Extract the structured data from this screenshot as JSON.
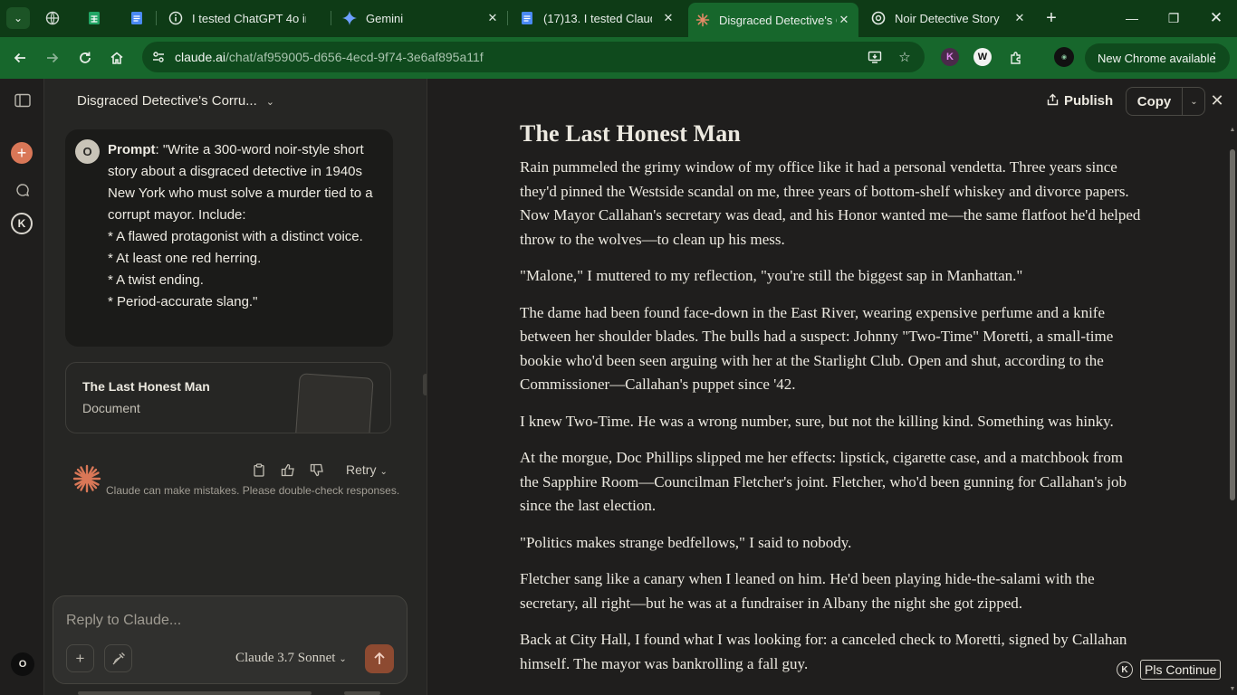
{
  "browser": {
    "tabs": [
      {
        "title": "",
        "icon": "globe-icon"
      },
      {
        "title": "",
        "icon": "sheets-icon"
      },
      {
        "title": "",
        "icon": "docs-icon"
      },
      {
        "title": "I tested ChatGPT 4o im",
        "icon": "info-icon"
      },
      {
        "title": "Gemini",
        "icon": "gemini-icon"
      },
      {
        "title": "(17)13. I tested Claude",
        "icon": "docs-icon"
      },
      {
        "title": "Disgraced Detective's C",
        "icon": "claude-icon",
        "active": true
      },
      {
        "title": "Noir Detective Story",
        "icon": "openai-icon"
      }
    ],
    "url_host": "claude.ai",
    "url_path": "/chat/af959005-d656-4ecd-9f74-3e6af895a11f",
    "update_label": "New Chrome available",
    "colors": {
      "frame": "#0e3b16",
      "toolbar": "#17672c"
    }
  },
  "chat": {
    "title": "Disgraced Detective's Corru...",
    "prompt_label": "Prompt",
    "prompt_lines": [
      ": \"Write a 300-word noir-style short story about a disgraced detective in 1940s New York who must solve a murder tied to a corrupt mayor. Include:",
      "* A flawed protagonist with a distinct voice.",
      "* At least one red herring.",
      "* A twist ending.",
      "* Period-accurate slang.\""
    ],
    "user_initial": "O",
    "artifact_card": {
      "title": "The Last Honest Man",
      "type": "Document"
    },
    "retry_label": "Retry",
    "disclaimer": "Claude can make mistakes. Please double-check responses.",
    "composer_placeholder": "Reply to Claude...",
    "model": "Claude 3.7 Sonnet"
  },
  "artifact": {
    "publish_label": "Publish",
    "copy_label": "Copy",
    "title": "The Last Honest Man",
    "paragraphs": [
      "Rain pummeled the grimy window of my office like it had a personal vendetta. Three years since they'd pinned the Westside scandal on me, three years of bottom-shelf whiskey and divorce papers. Now Mayor Callahan's secretary was dead, and his Honor wanted me—the same flatfoot he'd helped throw to the wolves—to clean up his mess.",
      "\"Malone,\" I muttered to my reflection, \"you're still the biggest sap in Manhattan.\"",
      "The dame had been found face-down in the East River, wearing expensive perfume and a knife between her shoulder blades. The bulls had a suspect: Johnny \"Two-Time\" Moretti, a small-time bookie who'd been seen arguing with her at the Starlight Club. Open and shut, according to the Commissioner—Callahan's puppet since '42.",
      "I knew Two-Time. He was a wrong number, sure, but not the killing kind. Something was hinky.",
      "At the morgue, Doc Phillips slipped me her effects: lipstick, cigarette case, and a matchbook from the Sapphire Room—Councilman Fletcher's joint. Fletcher, who'd been gunning for Callahan's job since the last election.",
      "\"Politics makes strange bedfellows,\" I said to nobody.",
      "Fletcher sang like a canary when I leaned on him. He'd been playing hide-the-salami with the secretary, all right—but he was at a fundraiser in Albany the night she got zipped.",
      "Back at City Hall, I found what I was looking for: a canceled check to Moretti, signed by Callahan himself. The mayor was bankrolling a fall guy."
    ]
  },
  "rail": {
    "user_initial": "O",
    "k_label": "K"
  },
  "extension": {
    "k_label": "K",
    "button_label": "Pls Continue"
  }
}
